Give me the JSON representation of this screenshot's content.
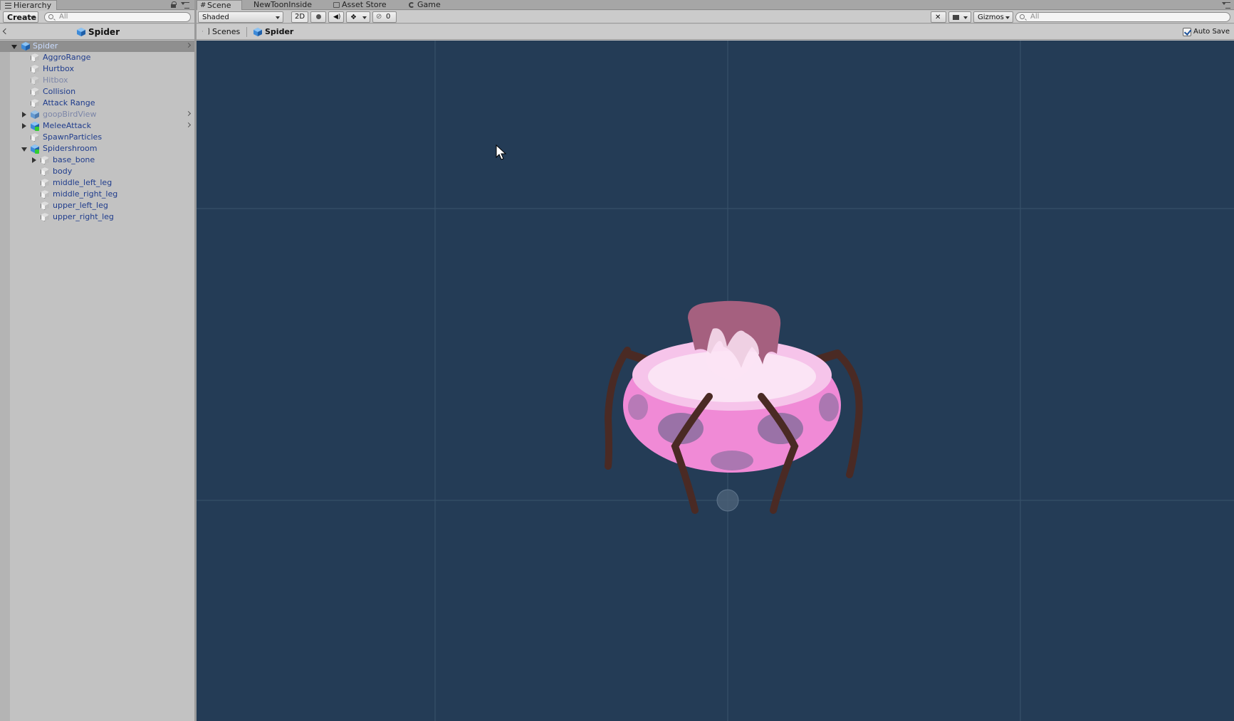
{
  "hierarchy": {
    "tab_label": "Hierarchy",
    "create_label": "Create",
    "search_placeholder": "All",
    "prefab_title": "Spider",
    "nodes": [
      {
        "label": "Spider"
      },
      {
        "label": "AggroRange"
      },
      {
        "label": "Hurtbox"
      },
      {
        "label": "Hitbox"
      },
      {
        "label": "Collision"
      },
      {
        "label": "Attack Range"
      },
      {
        "label": "goopBirdView"
      },
      {
        "label": "MeleeAttack"
      },
      {
        "label": "SpawnParticles"
      },
      {
        "label": "Spidershroom"
      },
      {
        "label": "base_bone"
      },
      {
        "label": "body"
      },
      {
        "label": "middle_left_leg"
      },
      {
        "label": "middle_right_leg"
      },
      {
        "label": "upper_left_leg"
      },
      {
        "label": "upper_right_leg"
      }
    ]
  },
  "scene": {
    "tabs": [
      {
        "label": "Scene"
      },
      {
        "label": "NewToonInside"
      },
      {
        "label": "Asset Store"
      },
      {
        "label": "Game"
      }
    ],
    "shading_mode": "Shaded",
    "mode_2d": "2D",
    "fx_count": "0",
    "gizmos_label": "Gizmos",
    "search_placeholder": "All",
    "breadcrumb_scenes": "Scenes",
    "breadcrumb_prefab": "Spider",
    "auto_save_label": "Auto Save",
    "auto_save_checked": true
  },
  "colors": {
    "viewport_bg": "#243c56",
    "selection_bg": "#8f8f8f",
    "node_text": "#1f3c8c",
    "spider_pink": "#f08ad6",
    "spider_cap": "#a5607f",
    "spider_legs": "#4a2a24"
  }
}
